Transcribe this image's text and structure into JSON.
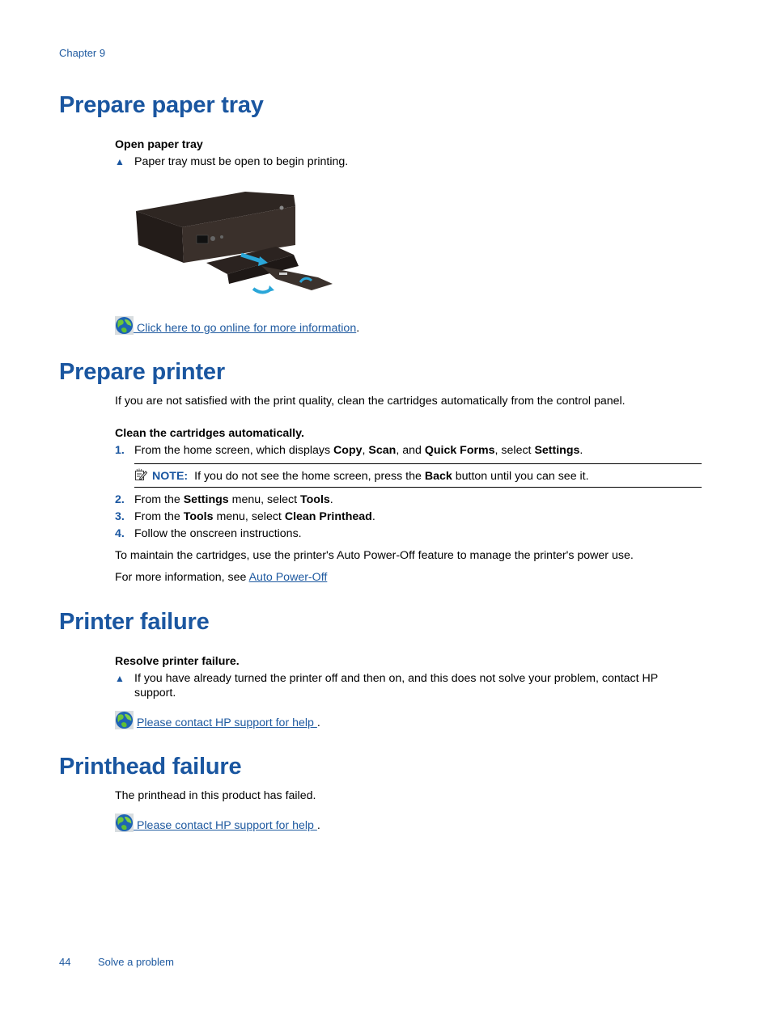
{
  "header": {
    "chapter": "Chapter 9"
  },
  "sections": {
    "paper_tray": {
      "title": "Prepare paper tray",
      "subheading": "Open paper tray",
      "bullet": "Paper tray must be open to begin printing.",
      "image_alt": "Printer with paper tray being opened",
      "link_text": " Click here to go online for more information",
      "link_suffix": "."
    },
    "prepare_printer": {
      "title": "Prepare printer",
      "intro": "If you are not satisfied with the print quality, clean the cartridges automatically from the control panel.",
      "subheading": "Clean the cartridges automatically.",
      "steps": [
        {
          "num": "1.",
          "parts": [
            "From the home screen, which displays ",
            "Copy",
            ", ",
            "Scan",
            ", and ",
            "Quick Forms",
            ", select ",
            "Settings",
            "."
          ]
        },
        {
          "num": "2.",
          "parts": [
            "From the ",
            "Settings",
            " menu, select ",
            "Tools",
            "."
          ]
        },
        {
          "num": "3.",
          "parts": [
            "From the ",
            "Tools",
            " menu, select ",
            "Clean Printhead",
            "."
          ]
        },
        {
          "num": "4.",
          "parts": [
            "Follow the onscreen instructions."
          ]
        }
      ],
      "note": {
        "label": "NOTE:",
        "parts": [
          "If you do not see the home screen, press the ",
          "Back",
          " button until you can see it."
        ]
      },
      "maintain": "To maintain the cartridges, use the printer's Auto Power-Off feature to manage the printer's power use.",
      "more_info_prefix": "For more information, see ",
      "more_info_link": "Auto Power-Off"
    },
    "printer_failure": {
      "title": "Printer failure",
      "subheading": "Resolve printer failure.",
      "bullet_line1": "If you have already turned the printer off and then on, and this does not solve your problem, contact HP",
      "bullet_line2": "support.",
      "link_text": "Please contact HP support for help ",
      "link_suffix": "."
    },
    "printhead_failure": {
      "title": "Printhead failure",
      "text": "The printhead in this product has failed.",
      "link_text": " Please contact HP support for help ",
      "link_suffix": "."
    }
  },
  "footer": {
    "page_number": "44",
    "section": "Solve a problem"
  },
  "colors": {
    "heading": "#1a56a0",
    "link": "#1f5aa0",
    "text": "#000000"
  }
}
